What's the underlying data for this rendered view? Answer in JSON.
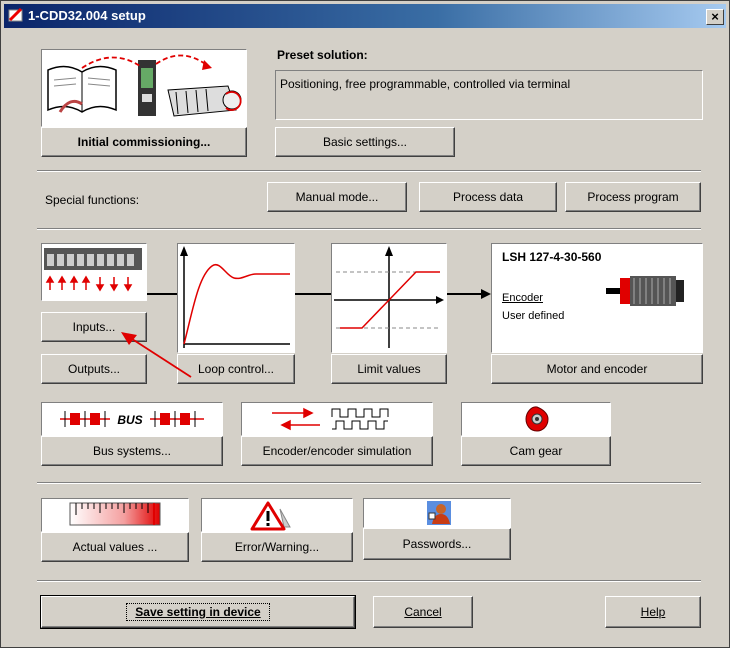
{
  "window": {
    "title": "1-CDD32.004 setup",
    "close_glyph": "×"
  },
  "preset": {
    "label": "Preset solution:",
    "value": "Positioning, free programmable, controlled via terminal"
  },
  "buttons": {
    "initial_commissioning": "Initial commissioning...",
    "basic_settings": "Basic settings...",
    "manual_mode": "Manual mode...",
    "process_data": "Process data",
    "process_program": "Process program",
    "inputs": "Inputs...",
    "outputs": "Outputs...",
    "loop_control": "Loop control...",
    "limit_values": "Limit values",
    "motor_encoder": "Motor and encoder",
    "bus_systems": "Bus systems...",
    "encoder_simulation": "Encoder/encoder simulation",
    "cam_gear": "Cam gear",
    "actual_values": "Actual values ...",
    "error_warning": "Error/Warning...",
    "passwords": "Passwords...",
    "save": "Save setting in device",
    "cancel": "Cancel",
    "help": "Help"
  },
  "labels": {
    "special_functions": "Special functions:"
  },
  "motor": {
    "model": "LSH 127-4-30-560",
    "encoder_label": "Encoder",
    "encoder_value": "User defined"
  },
  "bus_icon_text": "BUS",
  "icons": [
    "app-icon",
    "close-icon",
    "commissioning-icon",
    "io-terminal-icon",
    "step-response-icon",
    "limit-curve-icon",
    "motor-icon",
    "bus-icon",
    "encoder-signal-icon",
    "cam-gear-icon",
    "gauge-icon",
    "warning-icon",
    "password-user-icon",
    "annotation-arrow"
  ],
  "colors": {
    "title_bar_start": "#0a246a",
    "title_bar_end": "#a6caf0",
    "dialog_bg": "#d4d0c8",
    "accent_red": "#e00000"
  }
}
